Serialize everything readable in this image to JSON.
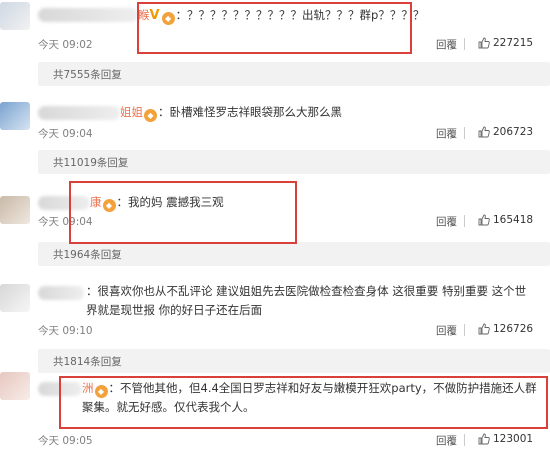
{
  "comments": [
    {
      "user_tail": "睺",
      "vip_badge": "V",
      "text": "：？？？？？？？？？？出轨？？？群p？？？？",
      "time": "今天 09:02",
      "reply_label": "回覆",
      "likes": "227215",
      "replies": "共7555条回复"
    },
    {
      "user_tail": "姐姐",
      "text": "：卧槽难怪罗志祥眼袋那么大那么黑",
      "time": "今天 09:04",
      "reply_label": "回覆",
      "likes": "206723",
      "replies": "共11019条回复"
    },
    {
      "user_tail": "康",
      "text": "：我的妈 震撼我三观",
      "time": "今天 09:04",
      "reply_label": "回覆",
      "likes": "165418",
      "replies": "共1964条回复"
    },
    {
      "text": "：很喜欢你也从不乱评论  建议姐姐先去医院做检查检查身体  这很重要  特别重要  这个世界就是现世报  你的好日子还在后面",
      "time": "今天 09:10",
      "reply_label": "回覆",
      "likes": "126726",
      "replies": "共1814条回复"
    },
    {
      "user_tail": "洲",
      "text": "：不管他其他，但4.4全国日罗志祥和好友与嫩模开狂欢party，不做防护措施还人群聚集。就无好感。仅代表我个人。",
      "time": "今天 09:05",
      "reply_label": "回覆",
      "likes": "123001"
    }
  ]
}
